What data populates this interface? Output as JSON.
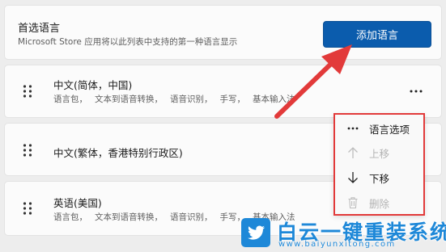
{
  "preferred": {
    "title": "首选语言",
    "description": "Microsoft Store 应用将以此列表中支持的第一种语言显示",
    "add_button_label": "添加语言"
  },
  "languages": [
    {
      "name": "中文(简体，中国)",
      "features": [
        "语言包，",
        "文本到语音转换，",
        "语音识别，",
        "手写，",
        "基本输入法"
      ],
      "more_icon": "more-horizontal-icon"
    },
    {
      "name": "中文(繁体，香港特别行政区)",
      "features": [],
      "more_icon": "more-horizontal-icon"
    },
    {
      "name": "英语(美国)",
      "features": [
        "语言包，",
        "文本到语音转换，",
        "语音识别，",
        "手写，",
        "基本输入法"
      ],
      "more_icon": "more-horizontal-icon"
    }
  ],
  "context_menu": {
    "items": [
      {
        "label": "语言选项",
        "icon": "more-horizontal-icon",
        "enabled": true
      },
      {
        "label": "上移",
        "icon": "arrow-up-icon",
        "enabled": false
      },
      {
        "label": "下移",
        "icon": "arrow-down-icon",
        "enabled": true
      },
      {
        "label": "删除",
        "icon": "trash-icon",
        "enabled": false
      }
    ],
    "highlight_color": "#e23a3a"
  },
  "annotation_arrow_color": "#e23a3a",
  "accent_color": "#0b5cad",
  "watermark": {
    "title": "白云一键重装系统",
    "url": "www.baiyunxitong.com",
    "logo_icon": "twitter-bird-icon",
    "color": "#1e88d8"
  }
}
